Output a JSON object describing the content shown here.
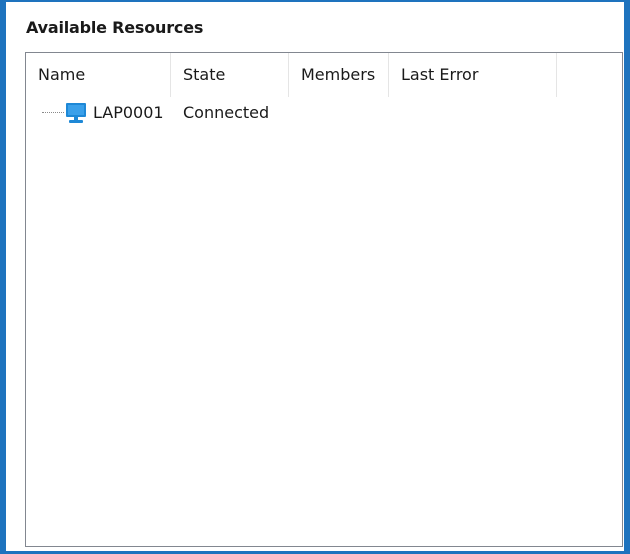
{
  "section": {
    "title": "Available Resources"
  },
  "table": {
    "columns": [
      "Name",
      "State",
      "Members",
      "Last Error"
    ],
    "rows": [
      {
        "icon": "computer-monitor-icon",
        "name": "LAP0001",
        "state": "Connected",
        "members": "",
        "last_error": ""
      }
    ]
  },
  "colors": {
    "frame_accent": "#1e73be",
    "monitor_icon": "#1e88d6"
  }
}
